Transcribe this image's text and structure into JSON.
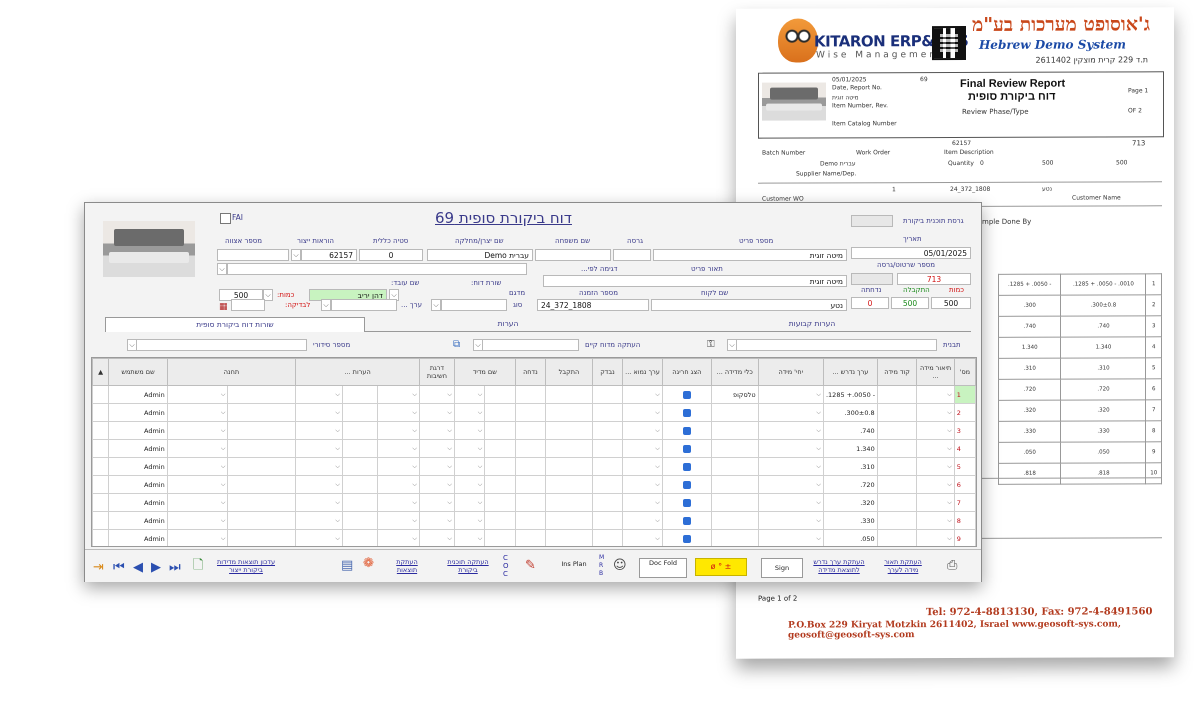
{
  "report": {
    "company_he": "ג'אוסופט מערכות בע\"מ",
    "company_en": "Hebrew Demo System",
    "address_he": "ת.ד 229 קרית מוצקין 2611402",
    "brand": "KITARON ERP&MES",
    "brand_sub": "Wise Management",
    "title_en": "Final Review Report",
    "title_he": "דוח ביקורת סופית",
    "date": "05/01/2025",
    "report_no": "69",
    "date_label": "Date, Report No.",
    "item_label": "Item Number, Rev.",
    "item_value": "מיטה זוגית",
    "catalog_label": "Item Catalog Number",
    "phase_label": "Review Phase/Type",
    "page_label": "Page 1",
    "of_label": "OF 2",
    "drawing_no": "713",
    "batch_label": "Batch Number",
    "work_order_label": "Work Order",
    "item_desc_label": "Item Description",
    "item_code": "62157",
    "qty_label": "Quantity",
    "qty": "500",
    "total_qty": "500",
    "accepted_qty": "500",
    "rejected_qty": "0",
    "supplier_label": "Supplier Name/Dep.",
    "supplier": "Demo עברית",
    "sales_order": "24_372_1808",
    "so_line": "1",
    "customer_label": "Customer Name",
    "customer": "נטע",
    "customer_wo_label": "Customer WO",
    "sample_label": "mple Done By",
    "rows": [
      [
        "1",
        ".1285 + .0050 - .0010",
        ".1285 + .0050 -"
      ],
      [
        "2",
        ".300±0.8",
        ".300"
      ],
      [
        "3",
        ".740",
        ".740"
      ],
      [
        "4",
        "1.340",
        "1.340"
      ],
      [
        "5",
        ".310",
        ".310"
      ],
      [
        "6",
        ".720",
        ".720"
      ],
      [
        "7",
        ".320",
        ".320"
      ],
      [
        "8",
        ".330",
        ".330"
      ],
      [
        "9",
        ".050",
        ".050"
      ],
      [
        "10",
        ".818",
        ".818"
      ]
    ],
    "page_of": "Page 1 of 2",
    "footer_tel": "Tel: 972-4-8813130, Fax: 972-4-8491560",
    "footer_addr": "P.O.Box 229 Kiryat Motzkin 2611402, Israel  www.geosoft-sys.com, geosoft@geosoft-sys.com"
  },
  "app": {
    "title": "דוח ביקורת סופית 69",
    "fai_label": "FAI",
    "labels": {
      "item_no": "מספר פריט",
      "version": "גרסה",
      "family": "שם משפחה",
      "supplier": "שם יצרן/מחלקה",
      "deviation": "סטיה כללית",
      "production_orders": "הוראות ייצור",
      "batch": "מספר אצווה",
      "date": "תאריך",
      "review_plan": "גרסת תוכנית ביקורת",
      "item_desc": "תאור פריט",
      "drawing": "מספר שרטוט/גרסה",
      "sample_by": "דגימה לפי...",
      "order_no": "מספר הזמנה",
      "customer": "שם לקוח",
      "qty": "כמות",
      "accepted": "התקבלה",
      "rejected": "נדחתה",
      "worker_line": "שורת דוח:",
      "worker": "שם עובד:",
      "amount": "כמות:",
      "check": "לבדיקה:",
      "sample_type": "סוג",
      "sampled": "מדגם",
      "value": "ערך ..."
    },
    "values": {
      "item": "מיטה זוגית",
      "supplier": "עברית Demo",
      "deviation": "0",
      "production_order": "62157",
      "date": "05/01/2025",
      "item_desc": "מיטה זוגית",
      "drawing": "713",
      "order_no": "24_372_1808",
      "customer": "נטע",
      "qty": "500",
      "accepted": "500",
      "rejected": "0",
      "worker": "דהן יריב",
      "amount": "500"
    },
    "tabs": [
      "שורות דוח ביקורת סופית",
      "הערות",
      "הערות קבועות"
    ],
    "filter_labels": {
      "serial": "מספר סידורי",
      "copy_from": "העתקה מדוח קיים",
      "template": "תבנית"
    },
    "columns": [
      "מס'",
      "מידה",
      "תיאור מידה ...",
      "קוד מידה",
      "ערך נדרש ...",
      "יחי' מידה",
      "כלי מדידה ...",
      "הצג חריגה",
      "ערך נמוא ...",
      "נבדק",
      "התקבל",
      "נדחה",
      "שם מדיד",
      "דרגת חשיבות",
      "הערות ...",
      "תחנה",
      "שם משתמש"
    ],
    "rows": [
      {
        "no": "1",
        "dim": ".1285 +.0050 -",
        "req": ".1285 +.0050 - .0010",
        "tool": "טלסקופ",
        "user": "Admin"
      },
      {
        "no": "2",
        "dim": ".300",
        "req": ".300±0.8",
        "tool": "",
        "user": "Admin"
      },
      {
        "no": "3",
        "dim": ".740",
        "req": ".740",
        "tool": "",
        "user": "Admin"
      },
      {
        "no": "4",
        "dim": "1.340",
        "req": "1.340",
        "tool": "",
        "user": "Admin"
      },
      {
        "no": "5",
        "dim": ".310",
        "req": ".310",
        "tool": "",
        "user": "Admin"
      },
      {
        "no": "6",
        "dim": ".720",
        "req": ".720",
        "tool": "",
        "user": "Admin"
      },
      {
        "no": "7",
        "dim": ".320",
        "req": ".320",
        "tool": "",
        "user": "Admin"
      },
      {
        "no": "8",
        "dim": ".330",
        "req": ".330",
        "tool": "",
        "user": "Admin"
      },
      {
        "no": "9",
        "dim": ".050",
        "req": ".050",
        "tool": "",
        "user": "Admin"
      }
    ],
    "toolbar": {
      "update_results": "עדכון תוצאות מדידות ביקורת ייצור",
      "copy_results": "העתקת תוצאות",
      "copy_plan": "העתקה תוכנית ביקורת",
      "copy_req": "העתקת ערך נדרש לתוצאת מדידה",
      "copy_desc": "העתקת תאור מידה לערך",
      "doc_fold": "Doc Fold",
      "sign": "Sign",
      "ins_plan": "Ins Plan"
    }
  }
}
